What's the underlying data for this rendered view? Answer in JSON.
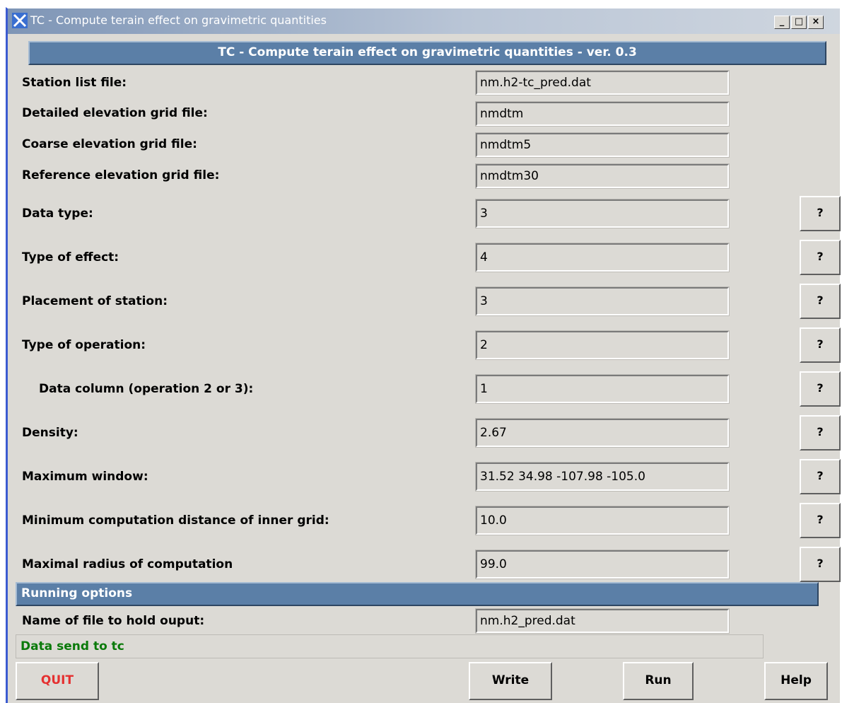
{
  "window": {
    "title": "TC - Compute terain effect on gravimetric quantities",
    "controls": {
      "minimize": "_",
      "maximize": "□",
      "close": "×"
    }
  },
  "header": {
    "title": "TC - Compute terain effect on gravimetric quantities - ver. 0.3"
  },
  "fields": {
    "station_list": {
      "label": "Station list file:",
      "value": "nm.h2-tc_pred.dat"
    },
    "detailed_grid": {
      "label": "Detailed elevation grid file:",
      "value": "nmdtm"
    },
    "coarse_grid": {
      "label": "Coarse elevation grid file:",
      "value": "nmdtm5"
    },
    "reference_grid": {
      "label": "Reference elevation grid file:",
      "value": "nmdtm30"
    },
    "data_type": {
      "label": "Data type:",
      "value": "3"
    },
    "type_of_effect": {
      "label": "Type of effect:",
      "value": "4"
    },
    "placement": {
      "label": "Placement of station:",
      "value": "3"
    },
    "operation": {
      "label": "Type of operation:",
      "value": "2"
    },
    "data_column": {
      "label": "Data column (operation 2 or 3):",
      "value": "1"
    },
    "density": {
      "label": "Density:",
      "value": "2.67"
    },
    "max_window": {
      "label": "Maximum window:",
      "value": "31.52 34.98 -107.98 -105.0"
    },
    "min_distance": {
      "label": "Minimum computation distance of inner grid:",
      "value": "10.0"
    },
    "max_radius": {
      "label": "Maximal radius of computation",
      "value": "99.0"
    }
  },
  "help_button_label": "?",
  "running": {
    "section_title": "Running options",
    "output_file": {
      "label": "Name of file to hold ouput:",
      "value": "nm.h2_pred.dat"
    }
  },
  "status": {
    "text": "Data send to tc"
  },
  "buttons": {
    "quit": "QUIT",
    "write": "Write",
    "run": "Run",
    "help": "Help"
  }
}
